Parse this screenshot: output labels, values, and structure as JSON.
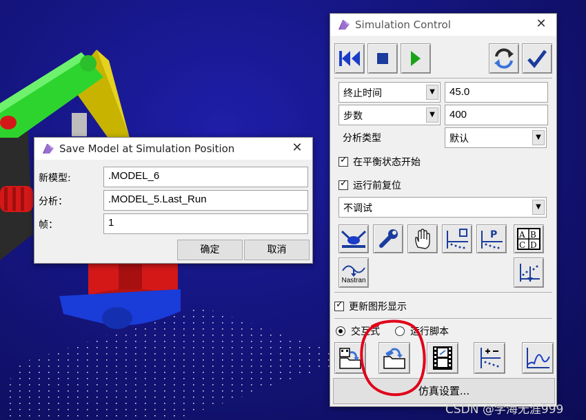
{
  "save_dialog": {
    "title": "Save Model at Simulation Position",
    "fields": [
      {
        "label": "新模型:",
        "value": ".MODEL_6"
      },
      {
        "label": "分析：",
        "value": ".MODEL_5.Last_Run"
      },
      {
        "label": "帧：",
        "value": "1"
      }
    ],
    "ok_label": "确定",
    "cancel_label": "取消"
  },
  "sim_control": {
    "title": "Simulation Control",
    "end_mode": {
      "selected": "终止时间",
      "value": "45.0"
    },
    "step_mode": {
      "selected": "步数",
      "value": "400"
    },
    "analysis_type": {
      "label": "分析类型",
      "selected": "默认"
    },
    "start_equilibrium": {
      "label": "在平衡状态开始",
      "checked": true
    },
    "reset_before_run": {
      "label": "运行前复位",
      "checked": true
    },
    "debug_mode": {
      "selected": "不调试"
    },
    "nastran_label": "Nastran",
    "update_graphics": {
      "label": "更新图形显示",
      "checked": true
    },
    "mode_interactive": "交互式",
    "mode_script": "运行脚本",
    "sim_settings_label": "仿真设置..."
  },
  "watermark": "CSDN @学海无涯999",
  "colors": {
    "annotation": "#e0001a",
    "play": "#1aa31a",
    "rewind": "#1a3cc8",
    "model_green": "#2ed42e",
    "model_red": "#d41818",
    "model_blue": "#1a3cd8"
  },
  "icons": [
    "rewind-icon",
    "stop-icon",
    "play-icon",
    "refresh-icon",
    "check-icon",
    "contact-icon",
    "wrench-icon",
    "hand-icon",
    "sensor-icon",
    "p-plot-icon",
    "abcd-table-icon",
    "nastran-icon",
    "measure-plot-icon",
    "load-state-icon",
    "save-state-icon",
    "animation-icon",
    "table-plot-icon",
    "plot-icon"
  ]
}
